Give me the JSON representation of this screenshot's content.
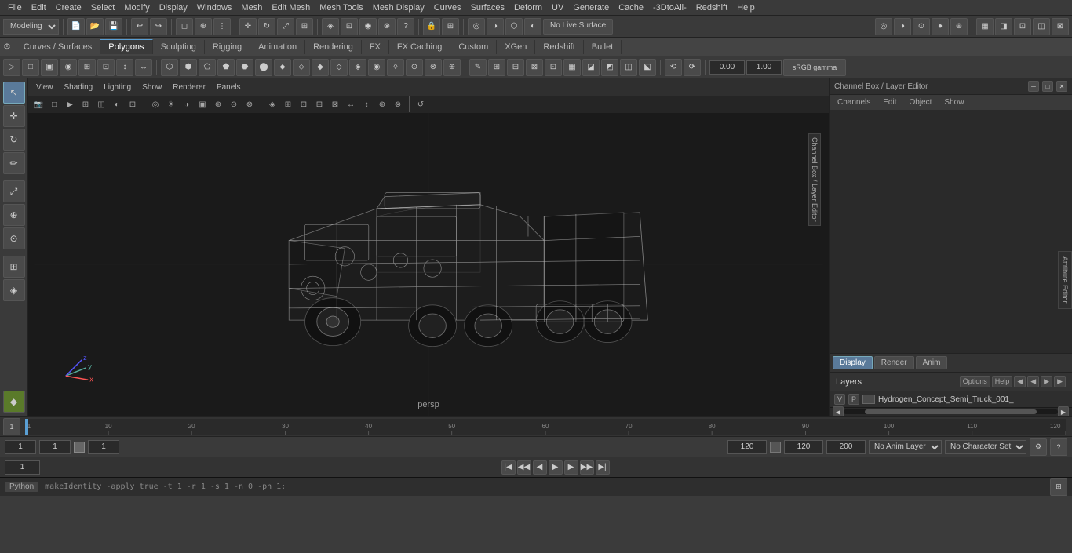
{
  "menubar": {
    "items": [
      "File",
      "Edit",
      "Create",
      "Select",
      "Modify",
      "Display",
      "Windows",
      "Mesh",
      "Edit Mesh",
      "Mesh Tools",
      "Mesh Display",
      "Curves",
      "Surfaces",
      "Deform",
      "UV",
      "Generate",
      "Cache",
      "-3DtoAll-",
      "Redshift",
      "Help"
    ]
  },
  "toolbar1": {
    "mode_select": "Modeling",
    "live_surface": "No Live Surface"
  },
  "tabs": {
    "items": [
      "Curves / Surfaces",
      "Polygons",
      "Sculpting",
      "Rigging",
      "Animation",
      "Rendering",
      "FX",
      "FX Caching",
      "Custom",
      "XGen",
      "Redshift",
      "Bullet"
    ],
    "active": "Polygons"
  },
  "viewport": {
    "menus": [
      "View",
      "Shading",
      "Lighting",
      "Show",
      "Renderer",
      "Panels"
    ],
    "camera_label": "persp",
    "gamma_value": "0.00",
    "exposure_value": "1.00",
    "color_space": "sRGB gamma"
  },
  "right_panel": {
    "title": "Channel Box / Layer Editor",
    "tabs": [
      "Display",
      "Render",
      "Anim"
    ],
    "active_tab": "Display",
    "subtabs": [
      "Channels",
      "Edit",
      "Object",
      "Show"
    ],
    "layer_title": "Layers",
    "layer_options": [
      "Options",
      "Help"
    ],
    "layer_item": {
      "v_label": "V",
      "p_label": "P",
      "name": "Hydrogen_Concept_Semi_Truck_001_"
    }
  },
  "timeline": {
    "start": "1",
    "end": "120",
    "current": "1",
    "range_start": "1",
    "range_end": "120",
    "max_range": "200",
    "markers": [
      "1",
      "10",
      "20",
      "30",
      "40",
      "50",
      "60",
      "70",
      "80",
      "90",
      "100",
      "110",
      "120"
    ]
  },
  "playback": {
    "frame_field": "1",
    "buttons": [
      "|◀◀",
      "◀◀",
      "◀",
      "▶",
      "▶▶",
      "▶▶|"
    ]
  },
  "bottom": {
    "field1": "1",
    "field2": "1",
    "field3": "1",
    "anim_layer": "No Anim Layer",
    "char_set": "No Character Set"
  },
  "status_bar": {
    "python_label": "Python",
    "command": "makeIdentity -apply true -t 1 -r 1 -s 1 -n 0 -pn 1;"
  },
  "side_tabs": [
    "Channel Box / Layer Editor",
    "Attribute Editor"
  ]
}
